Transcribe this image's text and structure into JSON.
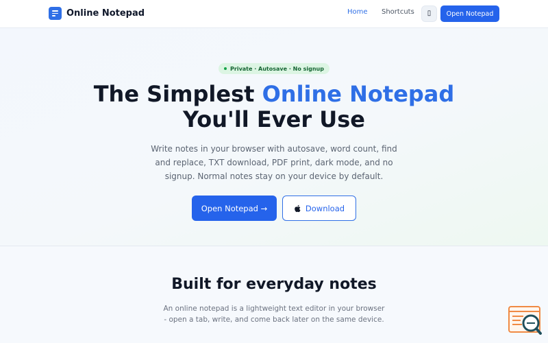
{
  "header": {
    "brand": "Online Notepad",
    "nav": {
      "home": "Home",
      "shortcuts": "Shortcuts",
      "theme_toggle_glyph": "▯",
      "cta": "Open Notepad"
    }
  },
  "hero": {
    "badge": "Private · Autosave · No signup",
    "title_part1": "The Simplest ",
    "title_accent": "Online Notepad",
    "title_part2": "You'll Ever Use",
    "description": "Write notes in your browser with autosave, word count, find and replace, TXT download, PDF print, dark mode, and no signup. Normal notes stay on your device by default.",
    "primary_button": "Open Notepad →",
    "secondary_button": "Download"
  },
  "section": {
    "title": "Built for everyday notes",
    "description": "An online notepad is a lightweight text editor in your browser - open a tab, write, and come back later on the same device."
  },
  "colors": {
    "accent": "#2563eb",
    "badge_bg": "#dcf5e3",
    "badge_text": "#166534",
    "widget_orange": "#f08a44",
    "widget_teal": "#1f4f5c"
  },
  "icons": {
    "logo": "notepad-logo-icon",
    "theme": "theme-toggle-icon",
    "apple": "apple-icon",
    "widget": "search-chat-widget-icon"
  }
}
